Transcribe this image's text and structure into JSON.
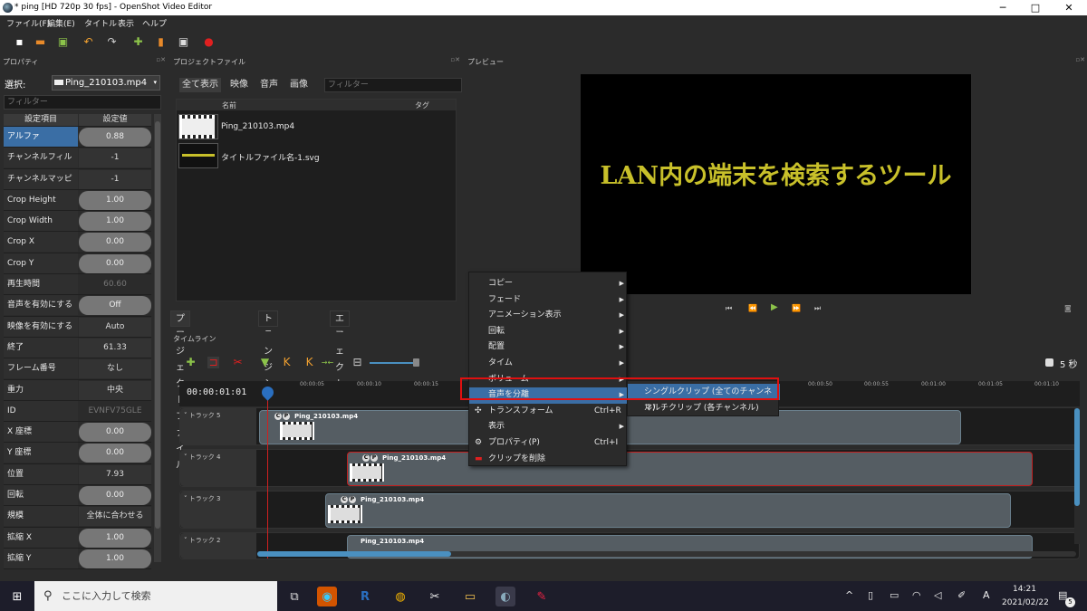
{
  "window": {
    "title": "* ping [HD 720p 30 fps] - OpenShot Video Editor",
    "min": "─",
    "max": "□",
    "close": "✕"
  },
  "menu": [
    "ファイル(F)",
    "編集(E)",
    "タイトル",
    "表示",
    "ヘルプ"
  ],
  "properties": {
    "title": "プロパティ",
    "selection_label": "選択:",
    "selection_value": "Ping_210103.mp4",
    "filter_placeholder": "フィルター",
    "col_key": "設定項目",
    "col_value": "設定値",
    "rows": [
      {
        "k": "アルファ",
        "v": "0.88"
      },
      {
        "k": "チャンネルフィルター",
        "v": "-1"
      },
      {
        "k": "チャンネルマッピング",
        "v": "-1"
      },
      {
        "k": "Crop Height",
        "v": "1.00"
      },
      {
        "k": "Crop Width",
        "v": "1.00"
      },
      {
        "k": "Crop X",
        "v": "0.00"
      },
      {
        "k": "Crop Y",
        "v": "0.00"
      },
      {
        "k": "再生時間",
        "v": "60.60"
      },
      {
        "k": "音声を有効にする",
        "v": "Off"
      },
      {
        "k": "映像を有効にする",
        "v": "Auto"
      },
      {
        "k": "終了",
        "v": "61.33"
      },
      {
        "k": "フレーム番号",
        "v": "なし"
      },
      {
        "k": "重力",
        "v": "中央"
      },
      {
        "k": "ID",
        "v": "EVNFV75GLE"
      },
      {
        "k": "X 座標",
        "v": "0.00"
      },
      {
        "k": "Y 座標",
        "v": "0.00"
      },
      {
        "k": "位置",
        "v": "7.93"
      },
      {
        "k": "回転",
        "v": "0.00"
      },
      {
        "k": "規模",
        "v": "全体に合わせる"
      },
      {
        "k": "拡縮 X",
        "v": "1.00"
      },
      {
        "k": "拡縮 Y",
        "v": "1.00"
      }
    ]
  },
  "project": {
    "title": "プロジェクトファイル",
    "filters": [
      "全て表示",
      "映像",
      "音声",
      "画像"
    ],
    "filter_placeholder": "フィルター",
    "col_name": "名前",
    "col_tag": "タグ",
    "files": [
      "Ping_210103.mp4",
      "タイトルファイル名-1.svg"
    ],
    "tabs": [
      "プロジェクトファイル",
      "トランジション",
      "エフェクト"
    ]
  },
  "preview": {
    "title": "プレビュー",
    "screen_text": "LAN内の端末を検索するツール"
  },
  "timeline": {
    "title": "タイムライン",
    "current_time": "00:00:01:01",
    "zoom_label": "5 秒",
    "ticks": [
      "00:00:05",
      "00:00:10",
      "00:00:15",
      "00:00:50",
      "00:00:55",
      "00:01:00",
      "00:01:05",
      "00:01:10"
    ],
    "tracks": [
      {
        "label": "トラック 5",
        "clip": "Ping_210103.mp4"
      },
      {
        "label": "トラック 4",
        "clip": "Ping_210103.mp4"
      },
      {
        "label": "トラック 3",
        "clip": "Ping_210103.mp4"
      },
      {
        "label": "トラック 2",
        "clip": "Ping_210103.mp4"
      }
    ]
  },
  "context_menu": {
    "items": [
      {
        "label": "コピー",
        "sub": true
      },
      {
        "label": "フェード",
        "sub": true
      },
      {
        "label": "アニメーション表示",
        "sub": true
      },
      {
        "label": "回転",
        "sub": true
      },
      {
        "label": "配置",
        "sub": true
      },
      {
        "label": "タイム",
        "sub": true
      },
      {
        "label": "ボリューム",
        "sub": true
      },
      {
        "label": "音声を分離",
        "sub": true
      },
      {
        "label": "トランスフォーム",
        "shortcut": "Ctrl+R"
      },
      {
        "label": "表示",
        "sub": true
      },
      {
        "label": "プロパティ(P)",
        "shortcut": "Ctrl+I"
      },
      {
        "label": "クリップを削除"
      }
    ],
    "submenu": [
      "シングルクリップ (全てのチャンネル)",
      "マルチクリップ (各チャンネル)"
    ]
  },
  "taskbar": {
    "search_placeholder": "ここに入力して検索",
    "time": "14:21",
    "date": "2021/02/22",
    "notifications": "5"
  },
  "colors": {
    "accent": "#3a6ea5",
    "highlight_box": "#e01010",
    "preview_text": "#c8c02a"
  }
}
